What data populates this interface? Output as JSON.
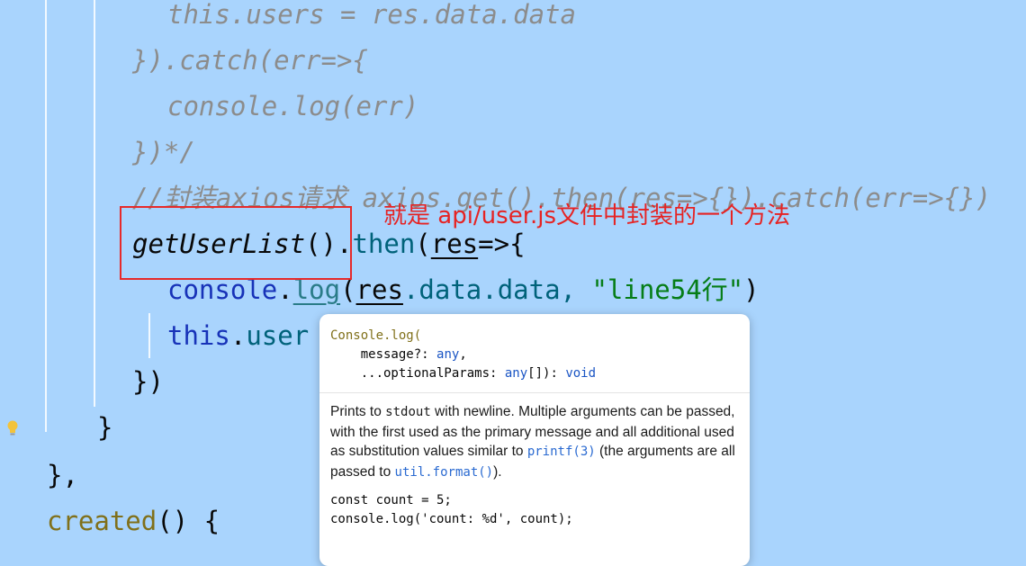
{
  "code": {
    "l1": {
      "t1": "this.users = res.data.data"
    },
    "l2": {
      "t1": "}).catch(err=>{"
    },
    "l3": {
      "t1": "console.log(err)"
    },
    "l4": {
      "t1": "})*/"
    },
    "l5": {
      "t1": "//封装axios请求 axios.get().then(res=>{}).catch(err=>{})"
    },
    "l6": {
      "fn": "getUserList",
      "paren": "()",
      "dot": ".",
      "then": "then",
      "open": "(",
      "res": "res",
      "arrow": "=>{"
    },
    "l7": {
      "console": "console",
      "dot": ".",
      "log": "log",
      "open": "(",
      "res": "res",
      "rest": ".data.data, ",
      "str": "\"line54行\"",
      "close": ")"
    },
    "l8": {
      "this": "this",
      "dot": ".",
      "user": "user"
    },
    "l9": {
      "t1": "})"
    },
    "l10": {
      "t1": "}"
    },
    "l11": {
      "t1": "},"
    },
    "l12": {
      "created": "created",
      "rest": "() {"
    }
  },
  "annotation": {
    "text": "就是 api/user.js文件中封装的一个方法",
    "color": "#e62323"
  },
  "popup": {
    "sig_name": "Console.log(",
    "sig_p1_name": "    message?: ",
    "sig_p1_type": "any",
    "sig_p1_end": ",",
    "sig_p2_name": "    ...optionalParams: ",
    "sig_p2_type": "any",
    "sig_p2_mid": "[]): ",
    "sig_p2_ret": "void",
    "doc_a": "Prints to ",
    "doc_stdout": "stdout",
    "doc_b": " with newline. Multiple arguments can be passed, with the first used as the primary message and all additional used as substitution values similar to ",
    "doc_printf": "printf(3)",
    "doc_c": " (the arguments are all passed to ",
    "doc_util": "util.format()",
    "doc_d": ").",
    "example_1": "const count = 5;",
    "example_2": "console.log('count: %d', count);"
  },
  "colors": {
    "background": "#a9d4fd",
    "comment": "#8c8c8c",
    "keyword": "#00627a",
    "string": "#067d17",
    "annotation_red": "#e62323"
  },
  "icons": {
    "gutter": "lightbulb-icon"
  }
}
